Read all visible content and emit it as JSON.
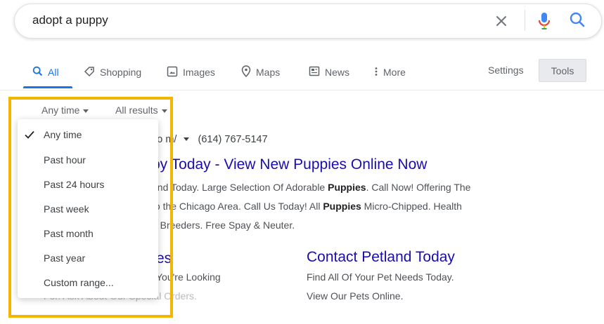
{
  "search": {
    "query": "adopt a puppy"
  },
  "tabs": [
    {
      "label": "All",
      "icon": "search-icon"
    },
    {
      "label": "Shopping",
      "icon": "tag-icon"
    },
    {
      "label": "Images",
      "icon": "image-icon"
    },
    {
      "label": "Maps",
      "icon": "map-pin-icon"
    },
    {
      "label": "News",
      "icon": "news-icon"
    },
    {
      "label": "More",
      "icon": "more-vert-icon"
    }
  ],
  "nav": {
    "settings": "Settings",
    "tools": "Tools"
  },
  "filters": {
    "time": "Any time",
    "results": "All results"
  },
  "time_menu": {
    "items": [
      "Any time",
      "Past hour",
      "Past 24 hours",
      "Past week",
      "Past month",
      "Past year",
      "Custom range..."
    ],
    "selected": "Any time"
  },
  "results": {
    "ad_url_fragment": "co m/",
    "ad_phone": "(614) 767-5147",
    "ad_title_fragment": "py Today - View New Puppies Online Now",
    "ad_snippet": {
      "line1_a": "end Today. Large Selection Of Adorable ",
      "line1_b": "Puppies",
      "line1_c": ". Call Now! Offering The",
      "line2_a": "to the Chicago Area. Call Us Today! All ",
      "line2_b": "Puppies",
      "line2_c": " Micro-Chipped. Health",
      "line3": "d Breeders. Free Spay & Neuter."
    },
    "sitelink_left": {
      "title_fragment": "es",
      "line1": "You're Looking",
      "line2": "For. Ask About Our Special Orders."
    },
    "sitelink_right": {
      "title": "Contact Petland Today",
      "line1": "Find All Of Your Pet Needs Today.",
      "line2": "View Our Pets Online."
    }
  },
  "colors": {
    "accent": "#1a73e8",
    "link": "#1a0dab",
    "highlight": "#f5b400"
  }
}
